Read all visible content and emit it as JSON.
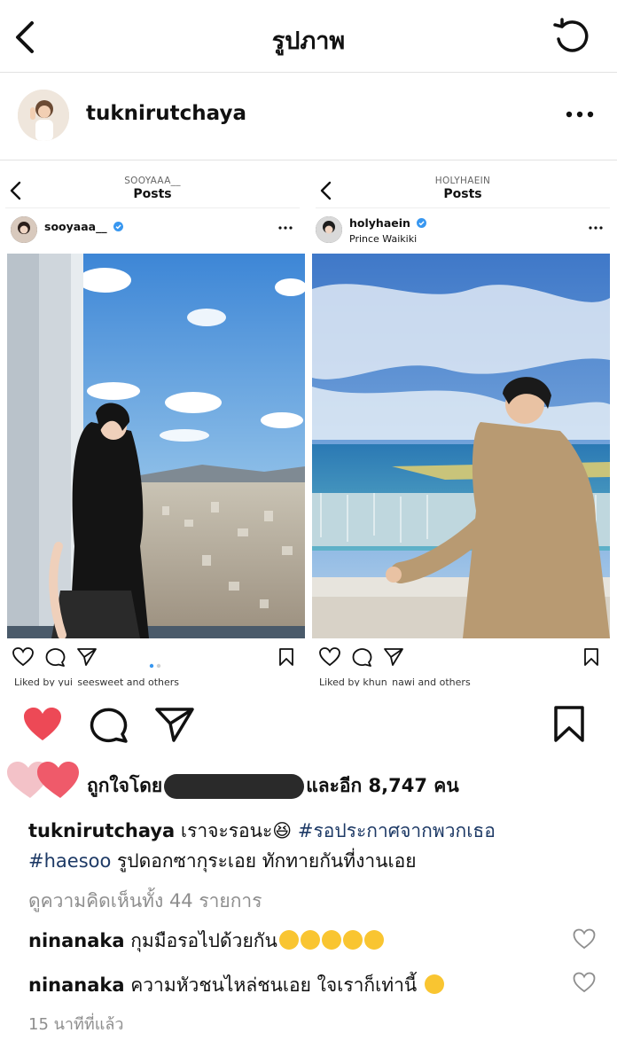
{
  "nav": {
    "title": "รูปภาพ"
  },
  "profile": {
    "username": "tuknirutchaya"
  },
  "post_image": {
    "left": {
      "top_label": "SOOYAAA__",
      "posts_label": "Posts",
      "username": "sooyaaa__",
      "liked_text": "Liked by yui_seesweet and others"
    },
    "right": {
      "top_label": "HOLYHAEIN",
      "posts_label": "Posts",
      "username": "holyhaein",
      "location": "Prince Waikiki",
      "liked_text": "Liked by khun_nawi and others"
    }
  },
  "likes": {
    "prefix": "ถูกใจโดย",
    "suffix": "และอีก 8,747 คน"
  },
  "caption": {
    "username": "tuknirutchaya",
    "text1": "เราจะรอนะ😆",
    "hashtag1": "#รอประกาศจากพวกเธอ",
    "hashtag2": "#haesoo",
    "text2": "รูปดอกซากุระเอย ทักทายกันที่งานเอย"
  },
  "view_comments": "ดูความคิดเห็นทั้ง 44 รายการ",
  "comments": [
    {
      "username": "ninanaka",
      "text": "กุมมือรอไปด้วยกัน"
    },
    {
      "username": "ninanaka",
      "text": "ความหัวชนไหล่ชนเอย ใจเราก็เท่านี้"
    }
  ],
  "timestamp": "15 นาทีที่แล้ว",
  "colors": {
    "like_red": "#ed4956",
    "hashtag": "#1e3a66",
    "muted": "#8e8e8e"
  },
  "icons": [
    "back-icon",
    "refresh-icon",
    "more-icon",
    "heart-icon",
    "comment-icon",
    "share-icon",
    "bookmark-icon"
  ]
}
